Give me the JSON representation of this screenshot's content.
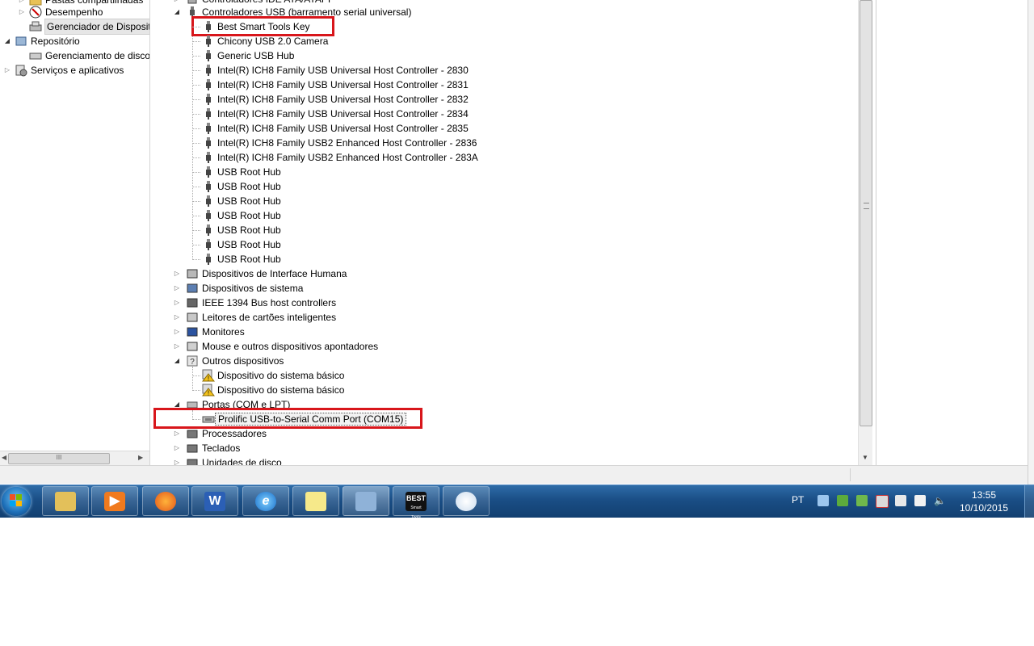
{
  "nav": {
    "items": [
      {
        "label": "Pastas compartilhadas",
        "icon": "shared-folder-icon"
      },
      {
        "label": "Desempenho",
        "icon": "performance-icon"
      },
      {
        "label": "Gerenciador de Disposit",
        "icon": "device-manager-icon"
      },
      {
        "label": "Repositório",
        "icon": "storage-icon"
      },
      {
        "label": "Gerenciamento de disco",
        "icon": "disk-management-icon"
      },
      {
        "label": "Serviços e aplicativos",
        "icon": "services-icon"
      }
    ],
    "scroll_grip": "III"
  },
  "tree": {
    "partial_top": "Controladores IDE ATA/ATAPI",
    "usb_category": "Controladores USB (barramento serial universal)",
    "usb_devices": [
      "Best Smart Tools Key",
      "Chicony USB 2.0 Camera",
      "Generic USB Hub",
      "Intel(R) ICH8 Family USB Universal Host Controller - 2830",
      "Intel(R) ICH8 Family USB Universal Host Controller - 2831",
      "Intel(R) ICH8 Family USB Universal Host Controller - 2832",
      "Intel(R) ICH8 Family USB Universal Host Controller - 2834",
      "Intel(R) ICH8 Family USB Universal Host Controller - 2835",
      "Intel(R) ICH8 Family USB2 Enhanced Host Controller - 2836",
      "Intel(R) ICH8 Family USB2 Enhanced Host Controller - 283A",
      "USB Root Hub",
      "USB Root Hub",
      "USB Root Hub",
      "USB Root Hub",
      "USB Root Hub",
      "USB Root Hub",
      "USB Root Hub"
    ],
    "categories_mid": [
      "Dispositivos de Interface Humana",
      "Dispositivos de sistema",
      "IEEE 1394 Bus host controllers",
      "Leitores de cartões inteligentes",
      "Monitores",
      "Mouse e outros dispositivos apontadores"
    ],
    "other_category": "Outros dispositivos",
    "other_devices": [
      "Dispositivo do sistema básico",
      "Dispositivo do sistema básico"
    ],
    "ports_category": "Portas (COM e LPT)",
    "ports_device": "Prolific USB-to-Serial Comm Port (COM15)",
    "categories_bottom": [
      "Processadores",
      "Teclados",
      "Unidades de disco"
    ]
  },
  "taskbar": {
    "language": "PT",
    "time": "13:55",
    "date": "10/10/2015",
    "word_letter": "W",
    "best_label": "BEST",
    "best_sub": "Smart Tools"
  },
  "colors": {
    "highlight_box": "#d8161b",
    "taskbar": "#1a4e86"
  }
}
